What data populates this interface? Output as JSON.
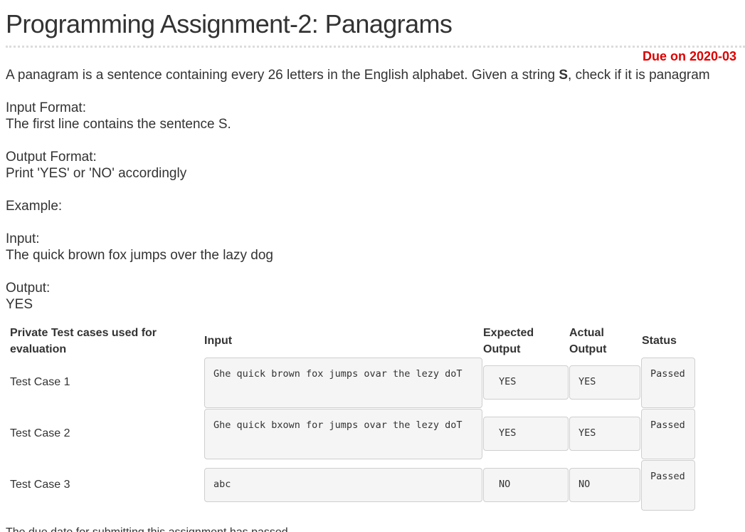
{
  "assignment": {
    "title": "Programming Assignment-2: Panagrams",
    "due_label": "Due on 2020-03"
  },
  "problem": {
    "description_before": "A panagram is a sentence containing every 26 letters in the English alphabet. Given a string ",
    "description_var": "S",
    "description_after": ", check if it is panagram",
    "input_format_heading": "Input Format:",
    "input_format_text": "The first line contains the sentence S.",
    "output_format_heading": "Output Format:",
    "output_format_text": "Print 'YES' or 'NO' accordingly",
    "example_heading": "Example:",
    "example_input_heading": "Input:",
    "example_input_text": "The quick brown fox jumps over the lazy dog",
    "example_output_heading": "Output:",
    "example_output_text": "YES"
  },
  "test_table": {
    "headers": {
      "test_case": "Private Test cases used for evaluation",
      "input": "Input",
      "expected": "Expected Output",
      "actual": "Actual Output",
      "status": "Status"
    },
    "rows": [
      {
        "label": "Test Case 1",
        "input": "Ghe quick brown fox jumps ovar the lezy doT",
        "expected": "YES",
        "actual": "YES",
        "status": "Passed"
      },
      {
        "label": "Test Case 2",
        "input": "Ghe quick bxown for jumps ovar the lezy doT",
        "expected": "YES",
        "actual": "YES",
        "status": "Passed"
      },
      {
        "label": "Test Case 3",
        "input": "abc",
        "expected": "NO",
        "actual": "NO",
        "status": "Passed"
      }
    ]
  },
  "footer": {
    "cut_off_text": "The due date for submitting this assignment has passed."
  }
}
